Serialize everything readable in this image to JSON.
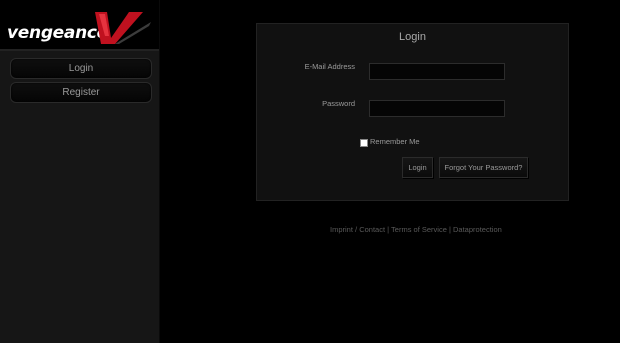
{
  "brand": {
    "logo_text": "vengeance"
  },
  "nav": {
    "login_label": "Login",
    "register_label": "Register"
  },
  "login_panel": {
    "title": "Login",
    "email_label": "E-Mail Address",
    "email_value": "",
    "password_label": "Password",
    "password_value": "",
    "remember_label": "Remember Me",
    "remember_checked": false,
    "login_button": "Login",
    "forgot_button": "Forgot Your Password?"
  },
  "footer": {
    "imprint": "Imprint",
    "contact": "Contact",
    "terms": "Terms of Service",
    "dataprotection": "Dataprotection",
    "sep_slash": " / ",
    "sep_bar": " | "
  },
  "colors": {
    "background": "#000000",
    "sidebar": "#161616",
    "panel": "#111111",
    "logo_accent": "#c0111f",
    "text": "#9a9a9a"
  }
}
